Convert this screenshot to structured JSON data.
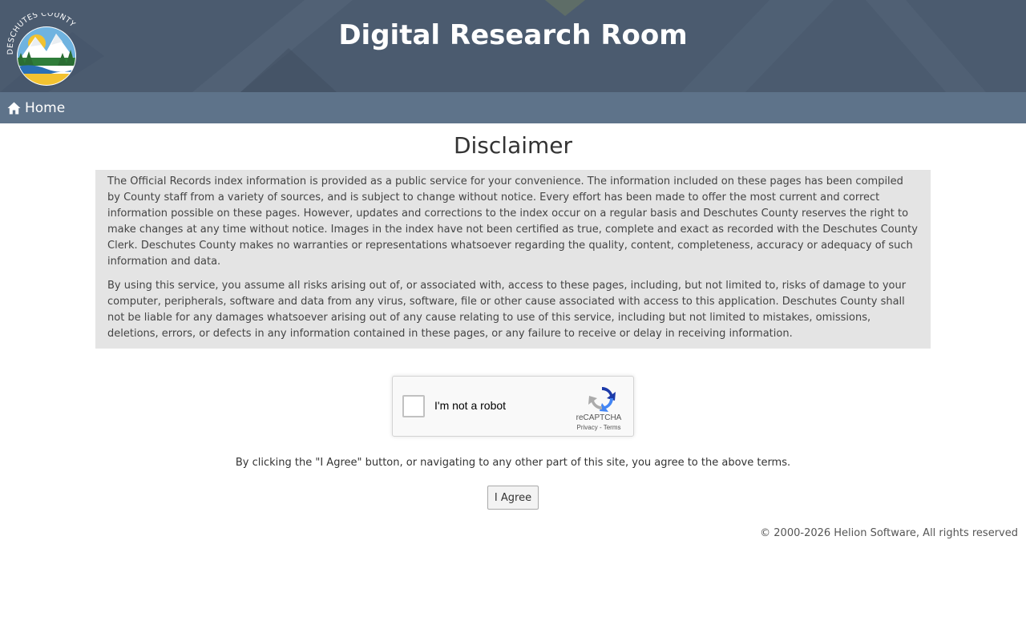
{
  "header": {
    "title": "Digital Research Room",
    "logo_text": "DESCHUTES COUNTY"
  },
  "nav": {
    "home_label": "Home",
    "home_icon": "home-icon"
  },
  "main": {
    "title": "Disclaimer",
    "paragraphs": [
      "The Official Records index information is provided as a public service for your convenience. The information included on these pages has been compiled by County staff from a variety of sources, and is subject to change without notice. Every effort has been made to offer the most current and correct information possible on these pages. However, updates and corrections to the index occur on a regular basis and Deschutes County reserves the right to make changes at any time without notice. Images in the index have not been certified as true, complete and exact as recorded with the Deschutes County Clerk. Deschutes County makes no warranties or representations whatsoever regarding the quality, content, completeness, accuracy or adequacy of such information and data.",
      "By using this service, you assume all risks arising out of, or associated with, access to these pages, including, but not limited to, risks of damage to your computer, peripherals, software and data from any virus, software, file or other cause associated with access to this application. Deschutes County shall not be liable for any damages whatsoever arising out of any cause relating to use of this service, including but not limited to mistakes, omissions, deletions, errors, or defects in any information contained in these pages, or any failure to receive or delay in receiving information."
    ],
    "recaptcha": {
      "label": "I'm not a robot",
      "brand": "reCAPTCHA",
      "privacy_label": "Privacy",
      "separator": " - ",
      "terms_label": "Terms"
    },
    "agree_note": "By clicking the \"I Agree\" button, or navigating to any other part of this site, you agree to the above terms.",
    "agree_button_label": "I Agree"
  },
  "footer": {
    "copyright": "© 2000-2026 Helion Software, All rights reserved"
  },
  "colors": {
    "banner": "#4a5a6e",
    "navbar": "#5e738a",
    "disclaimer_bg": "#e4e4e4"
  }
}
